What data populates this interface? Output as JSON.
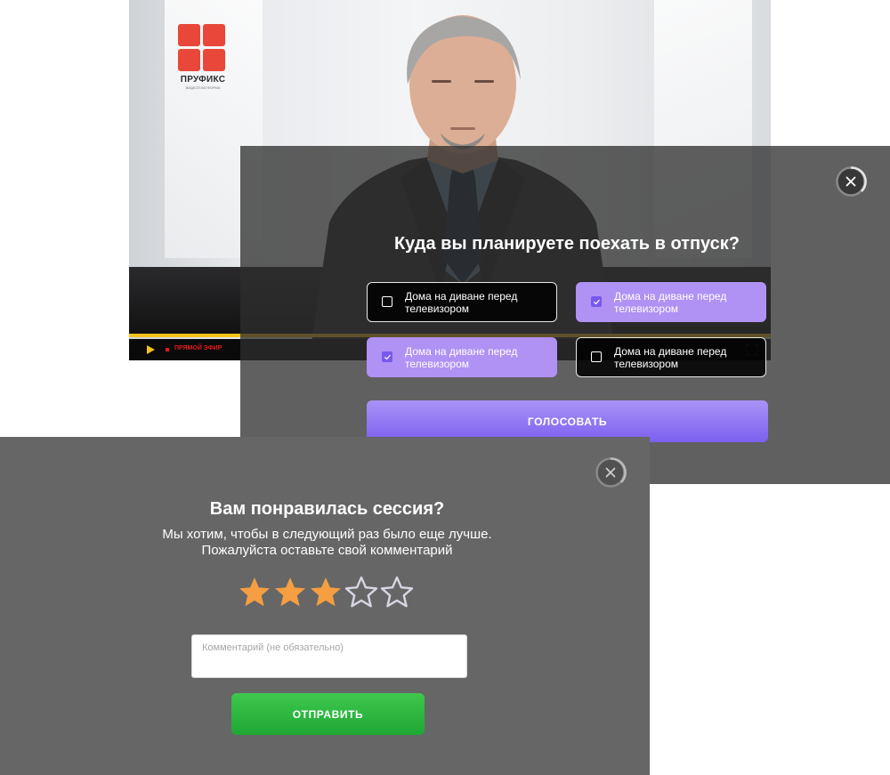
{
  "colors": {
    "accent_purple": "#7c60ef",
    "option_checked": "#b091f4",
    "submit_green": "#22ab37",
    "star_filled": "#f59e42",
    "star_empty": "#d7d7e4",
    "progress_yellow": "#f7c21a",
    "live_red": "#e21a1a"
  },
  "video": {
    "logo": {
      "brand": "ПРУФИКС",
      "tagline": "ВИДЕОПЛАТФОРМА"
    },
    "controls": {
      "play_icon": "play-icon",
      "live_label": "ПРЯМОЙ ЭФИР",
      "progress_percent": 100
    }
  },
  "poll": {
    "question": "Куда вы планируете поехать в отпуск?",
    "options": [
      {
        "label": "Дома на диване перед телевизором",
        "checked": false
      },
      {
        "label": "Дома на диване перед телевизором",
        "checked": true
      },
      {
        "label": "Дома на диване перед телевизором",
        "checked": true
      },
      {
        "label": "Дома на диване перед телевизором",
        "checked": false
      }
    ],
    "vote_label": "ГОЛОСОВАТЬ"
  },
  "feedback": {
    "title": "Вам понравилась сессия?",
    "subtitle_line1": "Мы хотим, чтобы в следующий раз было еще лучше.",
    "subtitle_line2": "Пожалуйста оставьте свой комментарий",
    "rating": 3,
    "rating_max": 5,
    "comment_placeholder": "Комментарий (не обязательно)",
    "comment_value": "",
    "submit_label": "ОТПРАВИТЬ"
  }
}
